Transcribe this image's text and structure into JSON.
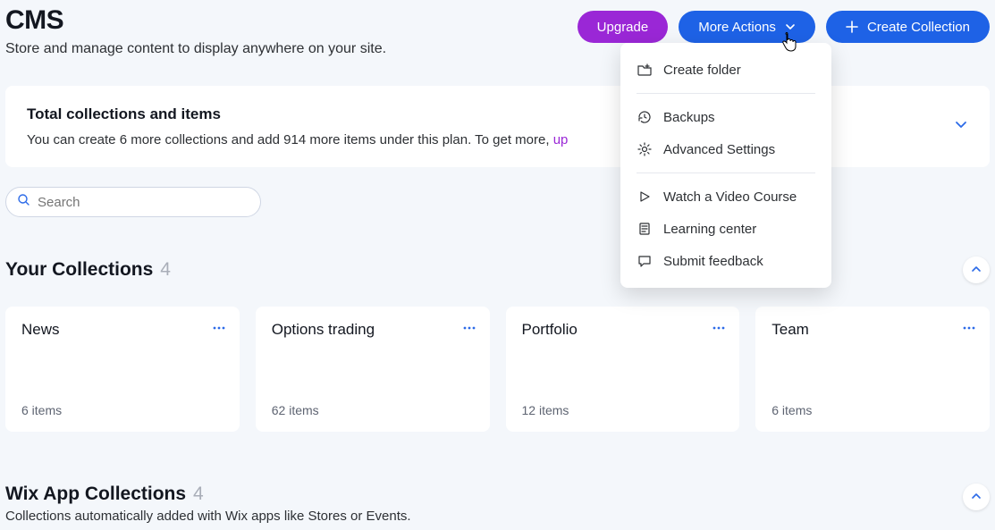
{
  "header": {
    "title": "CMS",
    "subtitle": "Store and manage content to display anywhere on your site.",
    "upgrade_label": "Upgrade",
    "more_actions_label": "More Actions",
    "create_collection_label": "Create Collection"
  },
  "banner": {
    "title": "Total collections and items",
    "text_before": "You can create 6 more collections and add 914 more items under this plan. To get more, ",
    "link_text": "up"
  },
  "search": {
    "placeholder": "Search"
  },
  "your_collections": {
    "title": "Your Collections",
    "count": "4",
    "items": [
      {
        "name": "News",
        "meta": "6 items"
      },
      {
        "name": "Options trading",
        "meta": "62 items"
      },
      {
        "name": "Portfolio",
        "meta": "12 items"
      },
      {
        "name": "Team",
        "meta": "6 items"
      }
    ]
  },
  "wix_collections": {
    "title": "Wix App Collections",
    "count": "4",
    "subtitle": "Collections automatically added with Wix apps like Stores or Events."
  },
  "dropdown": {
    "create_folder": "Create folder",
    "backups": "Backups",
    "advanced_settings": "Advanced Settings",
    "watch_video": "Watch a Video Course",
    "learning_center": "Learning center",
    "submit_feedback": "Submit feedback"
  }
}
